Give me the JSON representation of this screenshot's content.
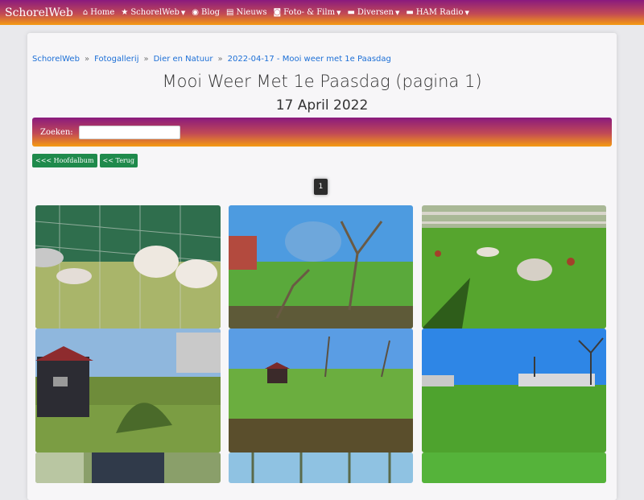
{
  "navbar": {
    "brand": "SchorelWeb",
    "items": [
      {
        "label": "Home",
        "icon": "home-icon",
        "glyph": "⌂",
        "dropdown": false
      },
      {
        "label": "SchorelWeb",
        "icon": "star-icon",
        "glyph": "★",
        "dropdown": true
      },
      {
        "label": "Blog",
        "icon": "rss-icon",
        "glyph": "◉",
        "dropdown": false
      },
      {
        "label": "Nieuws",
        "icon": "newspaper-icon",
        "glyph": "▤",
        "dropdown": false
      },
      {
        "label": "Foto- & Film",
        "icon": "camera-icon",
        "glyph": "◙",
        "dropdown": true
      },
      {
        "label": "Diversen",
        "icon": "folder-icon",
        "glyph": "▬",
        "dropdown": true
      },
      {
        "label": "HAM Radio",
        "icon": "folder-icon",
        "glyph": "▬",
        "dropdown": true
      }
    ]
  },
  "breadcrumb": [
    "SchorelWeb",
    "Fotogallerij",
    "Dier en Natuur",
    "2022-04-17 - Mooi weer met 1e Paasdag"
  ],
  "breadcrumb_separator": "»",
  "page": {
    "title": "Mooi Weer Met 1e Paasdag (pagina 1)",
    "date": "17 April 2022"
  },
  "search": {
    "label": "Zoeken:",
    "value": ""
  },
  "buttons": {
    "main_album": "<<< Hoofdalbum",
    "back": "<< Terug"
  },
  "pagination": {
    "current": "1"
  },
  "colors": {
    "gradient_top": "#8a1a7e",
    "gradient_bottom": "#f59b12",
    "button_green": "#1f8a4c",
    "link_blue": "#1c6fd6"
  }
}
